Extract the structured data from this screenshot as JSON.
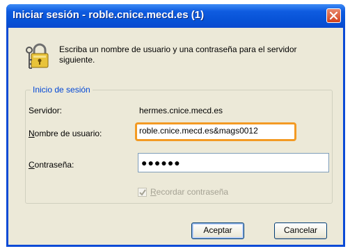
{
  "window": {
    "title": "Iniciar sesión - roble.cnice.mecd.es (1)"
  },
  "message": "Escriba un nombre de usuario y una contraseña para el servidor siguiente.",
  "group": {
    "legend": "Inicio de sesión"
  },
  "server": {
    "label": "Servidor:",
    "value": "hermes.cnice.mecd.es"
  },
  "username": {
    "label_first": "N",
    "label_rest": "ombre de usuario:",
    "value": "roble.cnice.mecd.es&mags0012"
  },
  "password": {
    "label_first": "C",
    "label_rest": "ontraseña:",
    "masked_value": "●●●●●●"
  },
  "remember": {
    "label_first": "R",
    "label_rest": "ecordar contraseña",
    "checked": true,
    "enabled": false
  },
  "buttons": {
    "ok": "Aceptar",
    "cancel": "Cancelar"
  },
  "icons": {
    "dialog": "keys-padlock-icon",
    "close": "close-icon",
    "check": "checkmark-icon"
  },
  "colors": {
    "title_bar": "#0a4ad6",
    "focus_ring": "#f39a23",
    "group_legend": "#0046d5",
    "dialog_bg": "#ece9d8"
  }
}
